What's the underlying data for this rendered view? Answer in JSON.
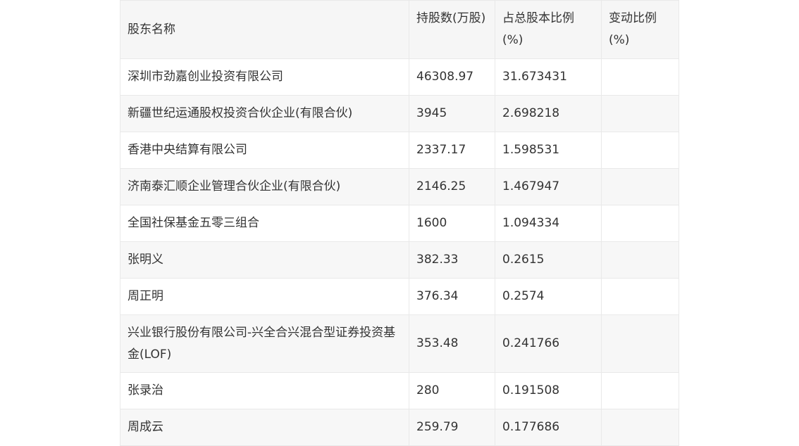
{
  "table": {
    "headers": [
      "股东名称",
      "持股数(万股)",
      "占总股本比例(%)",
      "变动比例(%)"
    ],
    "rows": [
      {
        "name": "深圳市劲嘉创业投资有限公司",
        "shares": "46308.97",
        "ratio": "31.673431",
        "change": ""
      },
      {
        "name": "新疆世纪运通股权投资合伙企业(有限合伙)",
        "shares": "3945",
        "ratio": "2.698218",
        "change": ""
      },
      {
        "name": "香港中央结算有限公司",
        "shares": "2337.17",
        "ratio": "1.598531",
        "change": ""
      },
      {
        "name": "济南泰汇顺企业管理合伙企业(有限合伙)",
        "shares": "2146.25",
        "ratio": "1.467947",
        "change": ""
      },
      {
        "name": "全国社保基金五零三组合",
        "shares": "1600",
        "ratio": "1.094334",
        "change": ""
      },
      {
        "name": "张明义",
        "shares": "382.33",
        "ratio": "0.2615",
        "change": ""
      },
      {
        "name": "周正明",
        "shares": "376.34",
        "ratio": "0.2574",
        "change": ""
      },
      {
        "name": "兴业银行股份有限公司-兴全合兴混合型证券投资基金(LOF)",
        "shares": "353.48",
        "ratio": "0.241766",
        "change": ""
      },
      {
        "name": "张录治",
        "shares": "280",
        "ratio": "0.191508",
        "change": ""
      },
      {
        "name": "周成云",
        "shares": "259.79",
        "ratio": "0.177686",
        "change": ""
      }
    ]
  }
}
